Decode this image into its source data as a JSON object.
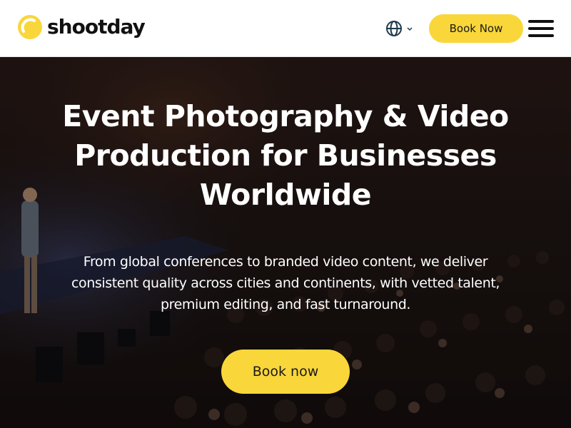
{
  "header": {
    "logo_text": "shootday",
    "language_icon": "globe-icon",
    "language_chevron": "chevron-down-icon",
    "book_label": "Book Now",
    "menu_icon": "hamburger-menu-icon"
  },
  "hero": {
    "title_line1": "Event Photography & Video",
    "title_line2": "Production for Businesses",
    "title_line3": "Worldwide",
    "subtitle_line1": "From global conferences to branded video content, we deliver",
    "subtitle_line2": "consistent quality across cities and continents, with vetted talent,",
    "subtitle_line3": "premium editing, and fast turnaround.",
    "cta_label": "Book now"
  },
  "colors": {
    "accent": "#f9d63a",
    "header_bg": "#ffffff",
    "text_dark": "#111111",
    "hero_text": "#ffffff"
  }
}
